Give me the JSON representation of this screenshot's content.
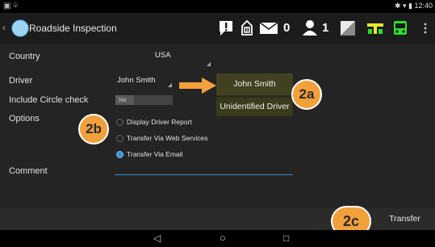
{
  "status_bar": {
    "left_icons": "▣ ⌾",
    "right_icons": "✱ ▾ ▮",
    "time": "12:40"
  },
  "action_bar": {
    "back_glyph": "‹",
    "title": "Roadside Inspection",
    "message_count": "0",
    "user_count": "1"
  },
  "form": {
    "country_label": "Country",
    "country_value": "USA",
    "driver_label": "Driver",
    "driver_value": "John Smith",
    "circle_label": "Include Circle check",
    "circle_toggle_value": "No",
    "options_label": "Options",
    "options": [
      {
        "label": "Display Driver Report",
        "selected": false
      },
      {
        "label": "Transfer Via Web Services",
        "selected": false
      },
      {
        "label": "Transfer Via Email",
        "selected": true
      }
    ],
    "comment_label": "Comment",
    "comment_value": ""
  },
  "driver_dropdown": {
    "options": [
      "John Smith",
      "Unidentified Driver"
    ]
  },
  "callouts": {
    "a": "2a",
    "b": "2b",
    "c": "2c"
  },
  "transfer_label": "Transfer",
  "nav": {
    "back": "◁",
    "home": "○",
    "recents": "□"
  },
  "colors": {
    "accent": "#3a8fd0",
    "callout": "#f2a13a",
    "icon_yellow": "#f0e82a",
    "icon_green": "#2fdc2f"
  }
}
